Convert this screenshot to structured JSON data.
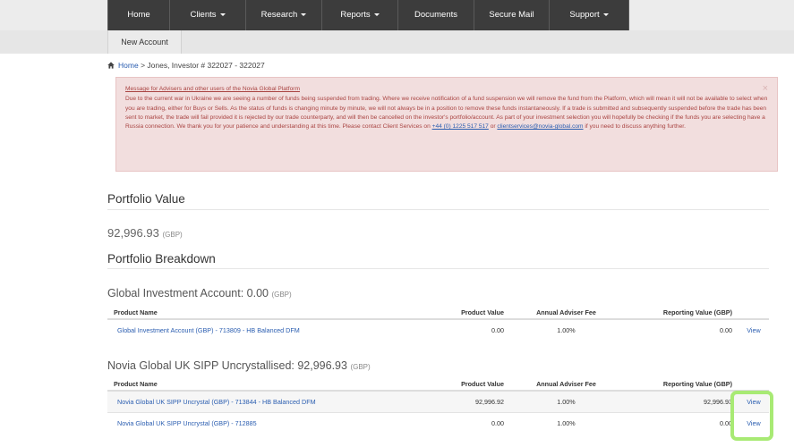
{
  "nav": {
    "items": [
      {
        "label": "Home",
        "dropdown": false
      },
      {
        "label": "Clients",
        "dropdown": true
      },
      {
        "label": "Research",
        "dropdown": true
      },
      {
        "label": "Reports",
        "dropdown": true
      },
      {
        "label": "Documents",
        "dropdown": false
      },
      {
        "label": "Secure Mail",
        "dropdown": false
      },
      {
        "label": "Support",
        "dropdown": true
      }
    ]
  },
  "subnav": {
    "new_account": "New Account"
  },
  "breadcrumb": {
    "home": "Home",
    "current": "> Jones, Investor # 322027 - 322027"
  },
  "alert": {
    "title": "Message for Advisers and other users of the Novia Global Platform",
    "body": "Due to the current war in Ukraine we are seeing a number of funds being suspended from trading. Where we receive notification of a fund suspension we will remove the fund from the Platform, which will mean it will not be available to select when you are trading, either for Buys or Sells. As the status of funds is changing minute by minute, we will not always be in a position to remove these funds instantaneously. If a trade is submitted and subsequently suspended before the trade has been sent to market, the trade will fail provided it is rejected by our trade counterparty, and will then be cancelled on the investor's portfolio/account. As part of your investment selection you will hopefully be checking if the funds you are selecting have a Russia connection. We thank you for your patience and understanding at this time. Please contact Client Services on",
    "phone": "+44 (0) 1225 517 517",
    "or": "or",
    "email": "clientservices@novia-global.com",
    "tail": "if you need to discuss anything further.",
    "close": "×"
  },
  "portfolio": {
    "value_heading": "Portfolio Value",
    "value": "92,996.93",
    "currency": "(GBP)",
    "breakdown_heading": "Portfolio Breakdown"
  },
  "accounts": [
    {
      "title": "Global Investment Account: 0.00",
      "currency": "(GBP)",
      "headers": [
        "Product Name",
        "Product Value",
        "Annual Adviser Fee",
        "Reporting Value (GBP)"
      ],
      "rows": [
        {
          "name": "Global Investment Account (GBP) - 713809 - HB Balanced DFM",
          "value": "0.00",
          "fee": "1.00%",
          "reporting": "0.00",
          "action": "View"
        }
      ]
    },
    {
      "title": "Novia Global UK SIPP Uncrystallised: 92,996.93",
      "currency": "(GBP)",
      "headers": [
        "Product Name",
        "Product Value",
        "Annual Adviser Fee",
        "Reporting Value (GBP)"
      ],
      "rows": [
        {
          "name": "Novia Global UK SIPP Uncrystal (GBP) - 713844 - HB Balanced DFM",
          "value": "92,996.92",
          "fee": "1.00%",
          "reporting": "92,996.93",
          "action": "View"
        },
        {
          "name": "Novia Global UK SIPP Uncrystal (GBP) - 712885",
          "value": "0.00",
          "fee": "1.00%",
          "reporting": "0.00",
          "action": "View"
        }
      ]
    }
  ],
  "colors": {
    "nav_bg": "#3c3c3c",
    "link": "#2a5db0",
    "alert_bg": "#f2dede",
    "alert_text": "#a94442",
    "highlight": "#a8ea74"
  }
}
